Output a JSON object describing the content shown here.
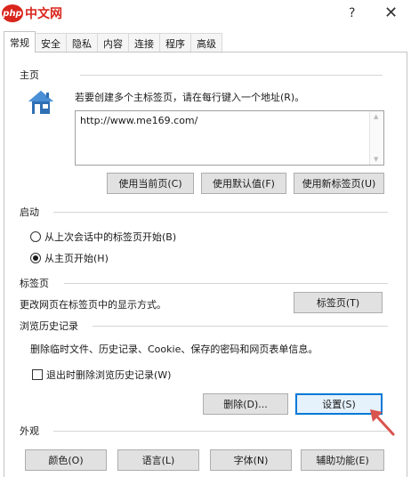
{
  "window": {
    "watermark_logo": "php",
    "watermark_text": "中文网",
    "help_label": "?",
    "close_label": "✕"
  },
  "tabs": [
    {
      "label": "常规",
      "active": true
    },
    {
      "label": "安全"
    },
    {
      "label": "隐私"
    },
    {
      "label": "内容"
    },
    {
      "label": "连接"
    },
    {
      "label": "程序"
    },
    {
      "label": "高级"
    }
  ],
  "home": {
    "heading": "主页",
    "icon": "house-icon",
    "description": "若要创建多个主标签页，请在每行键入一个地址(R)。",
    "url_value": "http://www.me169.com/",
    "buttons": {
      "current": "使用当前页(C)",
      "default": "使用默认值(F)",
      "new_tab": "使用新标签页(U)"
    }
  },
  "startup": {
    "heading": "启动",
    "options": [
      {
        "label": "从上次会话中的标签页开始(B)",
        "selected": false
      },
      {
        "label": "从主页开始(H)",
        "selected": true
      }
    ]
  },
  "tab_section": {
    "heading": "标签页",
    "description": "更改网页在标签页中的显示方式。",
    "button": "标签页(T)"
  },
  "history": {
    "heading": "浏览历史记录",
    "description": "删除临时文件、历史记录、Cookie、保存的密码和网页表单信息。",
    "checkbox_label": "退出时删除浏览历史记录(W)",
    "checkbox_checked": false,
    "delete_button": "删除(D)...",
    "settings_button": "设置(S)"
  },
  "appearance": {
    "heading": "外观",
    "buttons": {
      "colors": "颜色(O)",
      "languages": "语言(L)",
      "fonts": "字体(N)",
      "accessibility": "辅助功能(E)"
    }
  },
  "colors": {
    "accent_border": "#0078d7",
    "accent_fill": "#e5f1fb",
    "arrow": "#d9534f",
    "watermark": "#d9251c"
  }
}
